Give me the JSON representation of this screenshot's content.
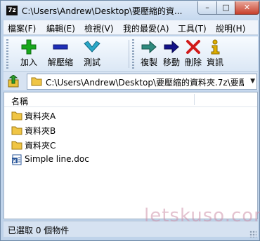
{
  "window": {
    "title": "C:\\Users\\Andrew\\Desktop\\要壓縮的資...",
    "app_icon_text": "7z",
    "min_glyph": "–",
    "max_glyph": "□",
    "close_glyph": "✕"
  },
  "menubar": {
    "items": [
      "檔案(F)",
      "編輯(E)",
      "檢視(V)",
      "我的最愛(A)",
      "工具(T)",
      "說明(H)"
    ]
  },
  "toolbar": {
    "buttons": [
      {
        "label": "加入",
        "icon": "plus-icon",
        "color": "#18a81c"
      },
      {
        "label": "解壓縮",
        "icon": "minus-icon",
        "color": "#1f2fb8"
      },
      {
        "label": "測試",
        "icon": "check-icon",
        "color": "#2aa8c8"
      },
      {
        "label": "複製",
        "icon": "copy-arrow-icon",
        "color": "#2e8a7e"
      },
      {
        "label": "移動",
        "icon": "move-arrow-icon",
        "color": "#12128a"
      },
      {
        "label": "刪除",
        "icon": "delete-x-icon",
        "color": "#d11a1a"
      },
      {
        "label": "資訊",
        "icon": "info-icon",
        "color": "#e0b000"
      }
    ]
  },
  "address": {
    "path": "C:\\Users\\Andrew\\Desktop\\要壓縮的資料夾.7z\\要壓"
  },
  "list": {
    "column_name": "名稱",
    "items": [
      {
        "name": "資料夾A",
        "type": "folder"
      },
      {
        "name": "資料夾B",
        "type": "folder"
      },
      {
        "name": "資料夾C",
        "type": "folder"
      },
      {
        "name": "Simple line.doc",
        "type": "document"
      }
    ]
  },
  "status": {
    "text": "已選取 0 個物件"
  },
  "watermark": "letskuso.com"
}
